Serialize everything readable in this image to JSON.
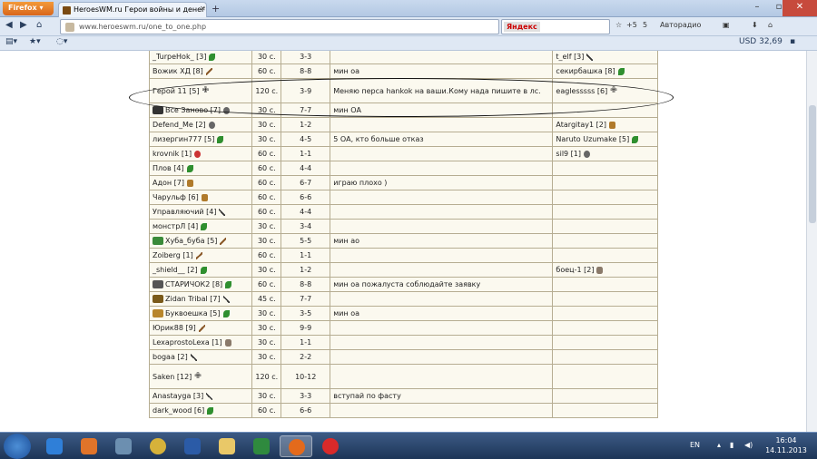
{
  "browser": {
    "firefox_label": "Firefox",
    "tab_title": "HeroesWM.ru Герои войны и денег. Он...",
    "url": "www.heroeswm.ru/one_to_one.php",
    "search_engine": "Яндекс",
    "indicators": [
      "+5",
      "5",
      "Авторадио"
    ],
    "currency": "USD 32,69"
  },
  "table": {
    "rows": [
      {
        "player": "_TurpeHok_ [3]",
        "icon": "leaf-icon",
        "time": "30 с.",
        "level": "3-3",
        "comment": "",
        "opponent": "t_elf [3]",
        "opp_icon": "stick-icon"
      },
      {
        "player": "Вожик ХД [8]",
        "icon": "sword-icon",
        "time": "60 с.",
        "level": "8-8",
        "comment": "мин оа",
        "opponent": "секирбашка [8]",
        "opp_icon": "leaf-icon"
      },
      {
        "player": "Герой 11 [5]",
        "icon": "cross-icon",
        "time": "120 с.",
        "level": "3-9",
        "comment": "Меняю перса hankok на ваши.Кому нада пишите в лс.",
        "opponent": "eaglesssss [6]",
        "opp_icon": "cross-icon",
        "tall": true
      },
      {
        "player": "Все Заново [7]",
        "icon": "skull-icon",
        "time": "30 с.",
        "level": "7-7",
        "comment": "мин ОА",
        "opponent": "",
        "opp_icon": "",
        "pre": "#333"
      },
      {
        "player": "Defend_Me [2]",
        "icon": "skull-icon",
        "time": "30 с.",
        "level": "1-2",
        "comment": "",
        "opponent": "Atargitay1 [2]",
        "opp_icon": "scroll-icon"
      },
      {
        "player": "лизергин777 [5]",
        "icon": "leaf-icon",
        "time": "30 с.",
        "level": "4-5",
        "comment": "5 ОА, кто больше отказ",
        "opponent": "Naruto Uzumake [5]",
        "opp_icon": "leaf-icon"
      },
      {
        "player": "krovnik [1]",
        "icon": "red-icon",
        "time": "60 с.",
        "level": "1-1",
        "comment": "",
        "opponent": "sil9 [1]",
        "opp_icon": "skull-icon"
      },
      {
        "player": "Плов [4]",
        "icon": "leaf-icon",
        "time": "60 с.",
        "level": "4-4",
        "comment": "",
        "opponent": "",
        "opp_icon": ""
      },
      {
        "player": "Адон [7]",
        "icon": "scroll-icon",
        "time": "60 с.",
        "level": "6-7",
        "comment": "играю плохо )",
        "opponent": "",
        "opp_icon": ""
      },
      {
        "player": "Чарульф [6]",
        "icon": "scroll-icon",
        "time": "60 с.",
        "level": "6-6",
        "comment": "",
        "opponent": "",
        "opp_icon": ""
      },
      {
        "player": "Управляючий [4]",
        "icon": "stick-icon",
        "time": "60 с.",
        "level": "4-4",
        "comment": "",
        "opponent": "",
        "opp_icon": ""
      },
      {
        "player": "монстрЛ [4]",
        "icon": "leaf-icon",
        "time": "30 с.",
        "level": "3-4",
        "comment": "",
        "opponent": "",
        "opp_icon": ""
      },
      {
        "player": "Хуба_буба [5]",
        "icon": "sword-icon",
        "time": "30 с.",
        "level": "5-5",
        "comment": "мин ао",
        "opponent": "",
        "opp_icon": "",
        "pre": "#3a8a3a"
      },
      {
        "player": "Zoiberg [1]",
        "icon": "sword-icon",
        "time": "60 с.",
        "level": "1-1",
        "comment": "",
        "opponent": "",
        "opp_icon": ""
      },
      {
        "player": "_shield__ [2]",
        "icon": "leaf-icon",
        "time": "30 с.",
        "level": "1-2",
        "comment": "",
        "opponent": "боец-1 [2]",
        "opp_icon": "cat-icon"
      },
      {
        "player": "СТАРИЧОК2 [8]",
        "icon": "leaf-icon",
        "time": "60 с.",
        "level": "8-8",
        "comment": "мин оа пожалуста соблюдайте заявку",
        "opponent": "",
        "opp_icon": "",
        "pre": "#555"
      },
      {
        "player": "Zidan Tribal [7]",
        "icon": "stick-icon",
        "time": "45 с.",
        "level": "7-7",
        "comment": "",
        "opponent": "",
        "opp_icon": "",
        "pre": "#7a5a1a"
      },
      {
        "player": "Буквоешка [5]",
        "icon": "leaf-icon",
        "time": "30 с.",
        "level": "3-5",
        "comment": "мин оа",
        "opponent": "",
        "opp_icon": "",
        "pre": "#b8862b"
      },
      {
        "player": "Юрик88 [9]",
        "icon": "sword-icon",
        "time": "30 с.",
        "level": "9-9",
        "comment": "",
        "opponent": "",
        "opp_icon": ""
      },
      {
        "player": "LexaprostoLexa [1]",
        "icon": "cat-icon",
        "time": "30 с.",
        "level": "1-1",
        "comment": "",
        "opponent": "",
        "opp_icon": ""
      },
      {
        "player": "bogaa [2]",
        "icon": "stick-icon",
        "time": "30 с.",
        "level": "2-2",
        "comment": "",
        "opponent": "",
        "opp_icon": ""
      },
      {
        "player": "Saken [12]",
        "icon": "cross-icon",
        "time": "120 с.",
        "level": "10-12",
        "comment": "",
        "opponent": "",
        "opp_icon": "",
        "tall": true
      },
      {
        "player": "Anastayga [3]",
        "icon": "stick-icon",
        "time": "30 с.",
        "level": "3-3",
        "comment": "вступай по фасту",
        "opponent": "",
        "opp_icon": ""
      },
      {
        "player": "dark_wood [6]",
        "icon": "leaf-icon",
        "time": "60 с.",
        "level": "6-6",
        "comment": "",
        "opponent": "",
        "opp_icon": ""
      }
    ]
  },
  "taskbar": {
    "lang": "EN",
    "time": "16:04",
    "date": "14.11.2013"
  }
}
